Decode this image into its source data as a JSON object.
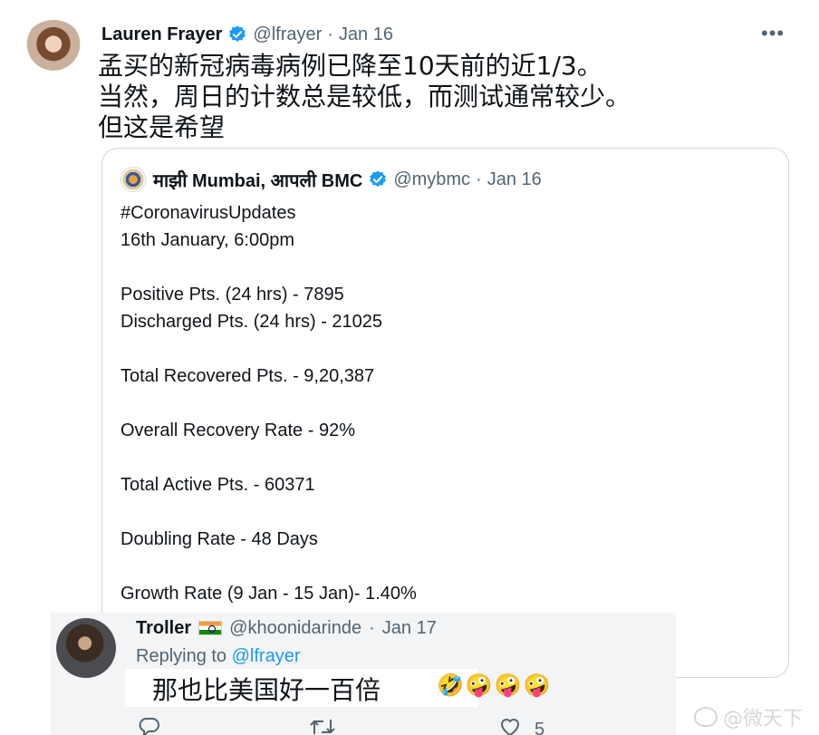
{
  "tweet": {
    "author_name": "Lauren Frayer",
    "author_handle": "@lfrayer",
    "separator": "·",
    "date": "Jan 16",
    "more": "•••",
    "lines": [
      "孟买的新冠病毒病例已降至10天前的近1/3。",
      "当然，周日的计数总是较低，而测试通常较少。",
      "但这是希望"
    ]
  },
  "quoted": {
    "author_name": "माझी Mumbai, आपली BMC",
    "author_handle": "@mybmc",
    "separator": "·",
    "date": "Jan 16",
    "lines": [
      "#CoronavirusUpdates",
      "16th January, 6:00pm",
      "",
      "Positive Pts. (24 hrs) - 7895",
      "Discharged Pts. (24 hrs) - 21025",
      "",
      "Total Recovered Pts. - 9,20,387",
      "",
      "Overall Recovery Rate - 92%",
      "",
      "Total Active Pts. - 60371",
      "",
      "Doubling Rate - 48 Days",
      "",
      "Growth Rate (9 Jan - 15 Jan)- 1.40%"
    ]
  },
  "reply": {
    "author_name": "Troller",
    "author_handle": "@khoonidarinde",
    "separator": "·",
    "date": "Jan 17",
    "replying_prefix": "Replying to ",
    "replying_to": "@lfrayer",
    "text": "那也比美国好一百倍",
    "emojis": "🤣🤪🤪🤪",
    "actions": {
      "reply_icon": "reply-icon",
      "retweet_icon": "retweet-icon",
      "like_icon": "like-icon",
      "like_count": "5"
    }
  },
  "watermark": {
    "text": "@微天下",
    "icon": "weibo-icon"
  },
  "colors": {
    "accent": "#1d9bf0",
    "secondary_text": "#536471",
    "border": "#cfd9de",
    "reply_background": "#f3f4f5"
  }
}
